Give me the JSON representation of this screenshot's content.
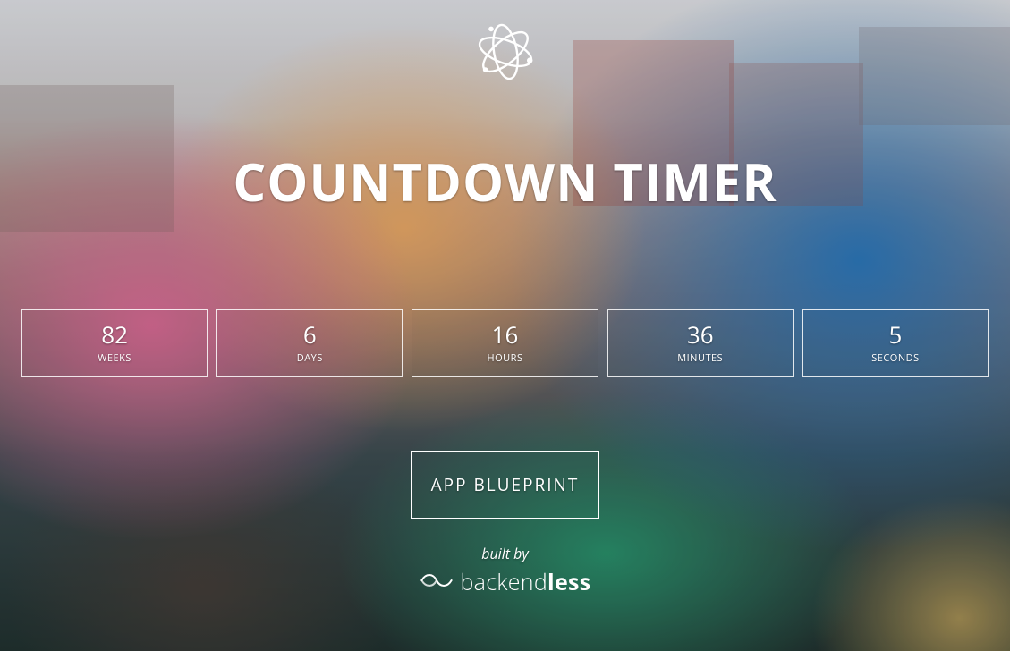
{
  "title": "COUNTDOWN TIMER",
  "timer": {
    "units": [
      {
        "value": "82",
        "label": "WEEKS"
      },
      {
        "value": "6",
        "label": "DAYS"
      },
      {
        "value": "16",
        "label": "HOURS"
      },
      {
        "value": "36",
        "label": "MINUTES"
      },
      {
        "value": "5",
        "label": "SECONDS"
      }
    ]
  },
  "cta": {
    "label": "APP BLUEPRINT"
  },
  "footer": {
    "built_by": "built by",
    "brand_prefix": "backend",
    "brand_suffix": "less"
  }
}
